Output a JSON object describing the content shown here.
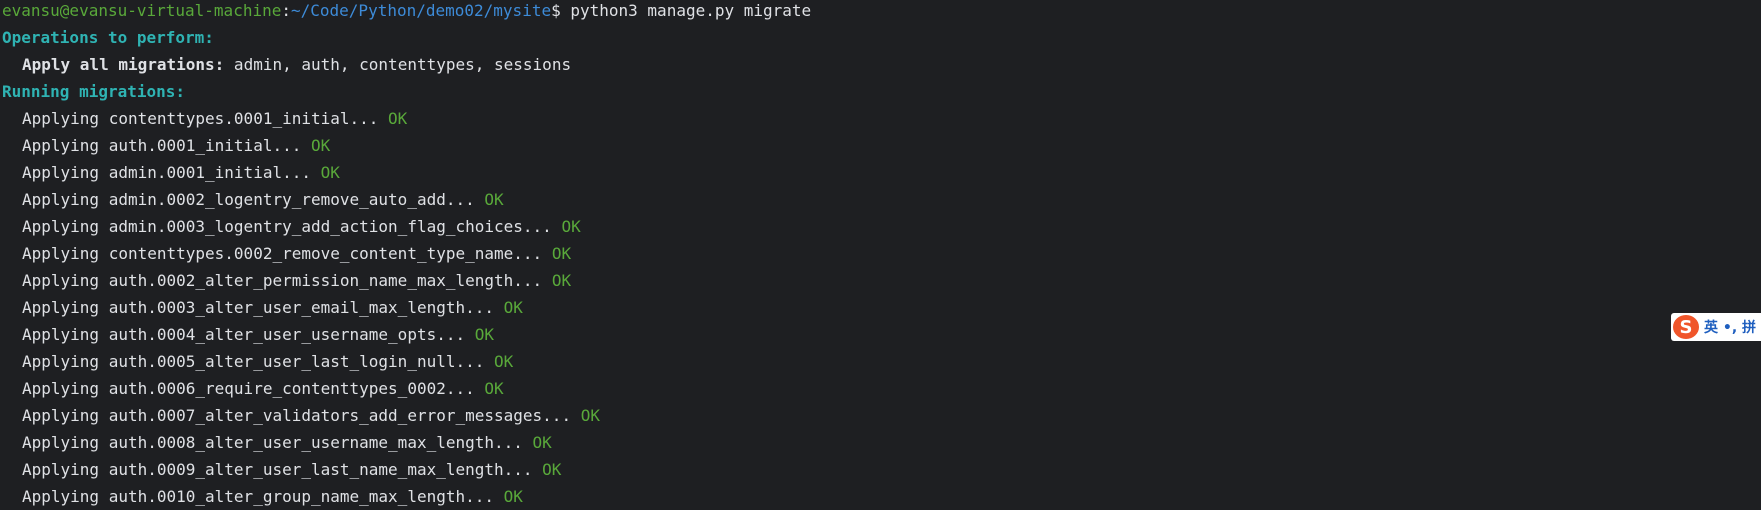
{
  "prompt": {
    "user_host": "evansu@evansu-virtual-machine",
    "separator": ":",
    "path": "~/Code/Python/demo02/mysite",
    "symbol": "$ ",
    "command": "python3 manage.py migrate"
  },
  "operations_header": "Operations to perform:",
  "apply_all": {
    "label": "Apply all migrations:",
    "apps": " admin, auth, contenttypes, sessions"
  },
  "running_header": "Running migrations:",
  "migrations": [
    {
      "text": "Applying contenttypes.0001_initial... ",
      "status": "OK"
    },
    {
      "text": "Applying auth.0001_initial... ",
      "status": "OK"
    },
    {
      "text": "Applying admin.0001_initial... ",
      "status": "OK"
    },
    {
      "text": "Applying admin.0002_logentry_remove_auto_add... ",
      "status": "OK"
    },
    {
      "text": "Applying admin.0003_logentry_add_action_flag_choices... ",
      "status": "OK"
    },
    {
      "text": "Applying contenttypes.0002_remove_content_type_name... ",
      "status": "OK"
    },
    {
      "text": "Applying auth.0002_alter_permission_name_max_length... ",
      "status": "OK"
    },
    {
      "text": "Applying auth.0003_alter_user_email_max_length... ",
      "status": "OK"
    },
    {
      "text": "Applying auth.0004_alter_user_username_opts... ",
      "status": "OK"
    },
    {
      "text": "Applying auth.0005_alter_user_last_login_null... ",
      "status": "OK"
    },
    {
      "text": "Applying auth.0006_require_contenttypes_0002... ",
      "status": "OK"
    },
    {
      "text": "Applying auth.0007_alter_validators_add_error_messages... ",
      "status": "OK"
    },
    {
      "text": "Applying auth.0008_alter_user_username_max_length... ",
      "status": "OK"
    },
    {
      "text": "Applying auth.0009_alter_user_last_name_max_length... ",
      "status": "OK"
    },
    {
      "text": "Applying auth.0010_alter_group_name_max_length... ",
      "status": "OK"
    }
  ],
  "ime": {
    "logo": "S",
    "text": "英 •, 拼"
  },
  "colors": {
    "background": "#1e1f22",
    "user_host": "#59a83a",
    "path": "#3d8bd8",
    "header": "#2fb3b3",
    "ok": "#59a83a"
  }
}
